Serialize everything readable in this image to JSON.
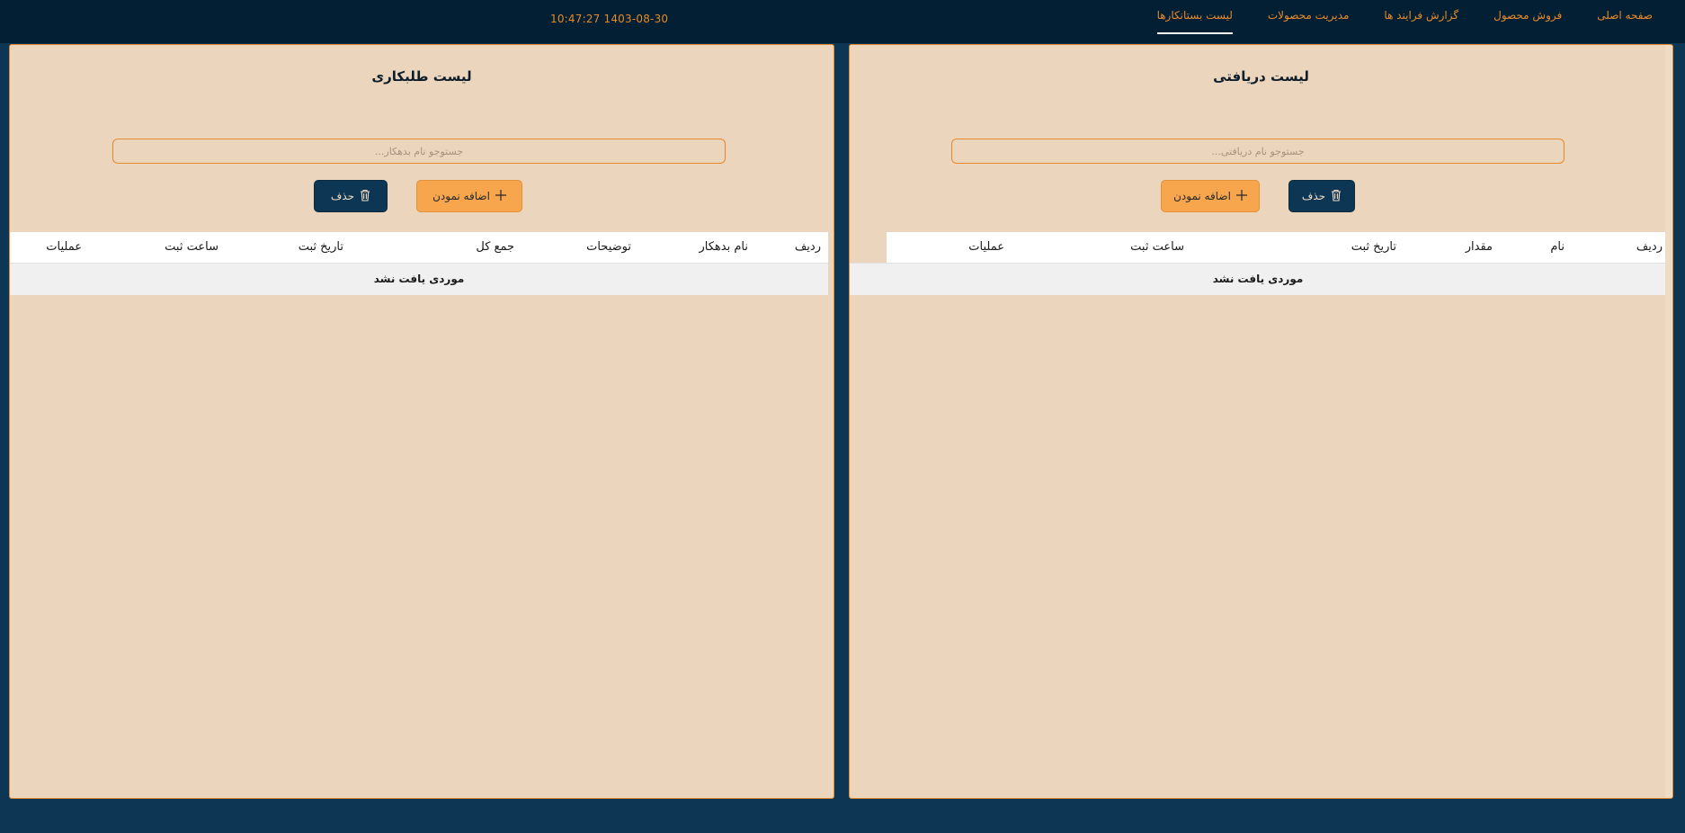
{
  "header": {
    "clock": "10:47:27 1403-08-30",
    "nav": [
      {
        "label": "صفحه اصلی"
      },
      {
        "label": "فروش محصول"
      },
      {
        "label": "گزارش فرایند ها"
      },
      {
        "label": "مدیریت محصولات"
      },
      {
        "label": "لیست بستانکارها",
        "active": true
      }
    ]
  },
  "received": {
    "title": "لیست دریافتی",
    "search_placeholder": "جستوجو نام دریافتی...",
    "add_label": "اضافه نمودن",
    "delete_label": "حذف",
    "columns": [
      "ردیف",
      "نام",
      "مقدار",
      "تاریخ ثبت",
      "ساعت ثبت",
      "عملیات"
    ],
    "empty_text": "موردی یافت نشد"
  },
  "debts": {
    "title": "لیست طلبکاری",
    "search_placeholder": "جستوجو نام بدهکار...",
    "add_label": "اضافه نمودن",
    "delete_label": "حذف",
    "columns": [
      "ردیف",
      "نام بدهکار",
      "توضیحات",
      "جمع کل",
      "تاریخ ثبت",
      "ساعت ثبت",
      "عملیات"
    ],
    "empty_text": "موردی یافت نشد"
  },
  "colors": {
    "topbar": "#021f33",
    "background": "#0d3654",
    "panel": "#ebd5bc",
    "accent": "#e58a2c",
    "add_button": "#f7a64d",
    "delete_button": "#0d3654"
  },
  "icons": {
    "add": "plus-icon",
    "delete": "trash-icon"
  }
}
